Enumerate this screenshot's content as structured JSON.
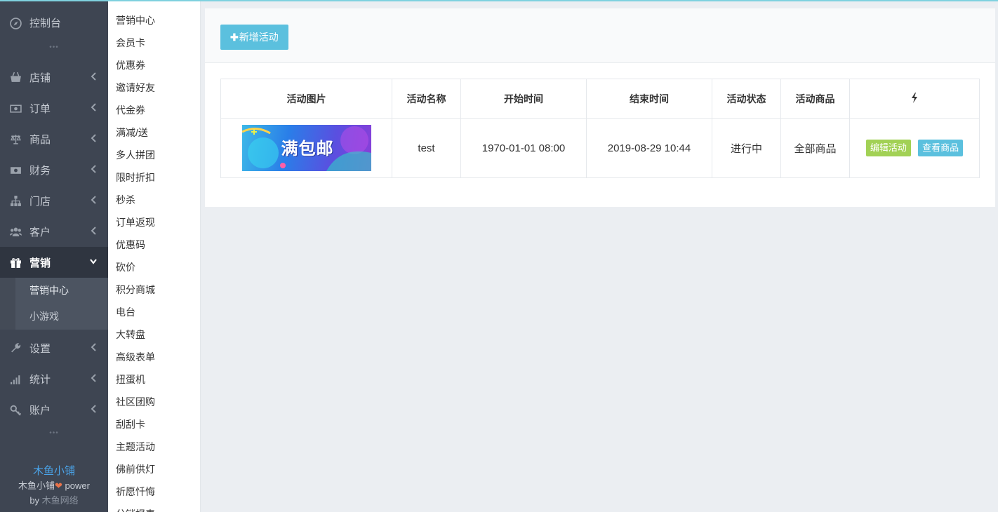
{
  "sidebar": {
    "console_label": "控制台",
    "items": [
      {
        "label": "店铺",
        "icon": "shop-icon"
      },
      {
        "label": "订单",
        "icon": "money-icon"
      },
      {
        "label": "商品",
        "icon": "scale-icon"
      },
      {
        "label": "财务",
        "icon": "cash-icon"
      },
      {
        "label": "门店",
        "icon": "sitemap-icon"
      },
      {
        "label": "客户",
        "icon": "users-icon"
      },
      {
        "label": "营销",
        "icon": "gift-icon"
      },
      {
        "label": "设置",
        "icon": "wrench-icon"
      },
      {
        "label": "统计",
        "icon": "signal-icon"
      },
      {
        "label": "账户",
        "icon": "key-icon"
      }
    ],
    "marketing_sub": [
      "营销中心",
      "小游戏"
    ],
    "footer": {
      "brand": "木鱼小铺",
      "power_prefix": "木鱼小铺",
      "power_suffix": " power",
      "by": "by ",
      "company": "木鱼网络"
    }
  },
  "submenu": [
    "营销中心",
    "会员卡",
    "优惠券",
    "邀请好友",
    "代金券",
    "满减/送",
    "多人拼团",
    "限时折扣",
    "秒杀",
    "订单返现",
    "优惠码",
    "砍价",
    "积分商城",
    "电台",
    "大转盘",
    "高级表单",
    "扭蛋机",
    "社区团购",
    "刮刮卡",
    "主题活动",
    "佛前供灯",
    "祈愿忏悔",
    "分销报表"
  ],
  "toolbar": {
    "new_label": "新增活动"
  },
  "table": {
    "headers": [
      "活动图片",
      "活动名称",
      "开始时间",
      "结束时间",
      "活动状态",
      "活动商品",
      "⚡"
    ],
    "rows": [
      {
        "image_text": "满包邮",
        "name": "test",
        "start": "1970-01-01 08:00",
        "end": "2019-08-29 10:44",
        "status": "进行中",
        "goods": "全部商品",
        "edit_label": "编辑活动",
        "view_label": "查看商品"
      }
    ]
  },
  "colors": {
    "accent": "#5bc0de",
    "sidebar": "#3e4552",
    "edit": "#a2d155"
  }
}
